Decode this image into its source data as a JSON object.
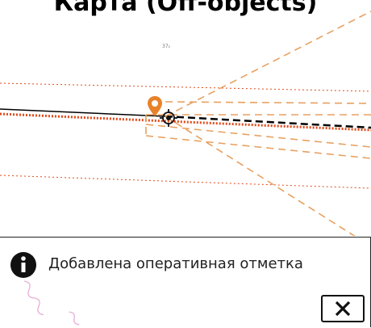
{
  "header": {
    "title": "Карта (Off-objects)"
  },
  "map": {
    "parcel_label": "37₂",
    "colors": {
      "boundary": "#e8a060",
      "red_line": "#e04a1a",
      "track": "#000000",
      "pin": "#e8822a"
    },
    "icons": [
      "location-pin-icon",
      "crosshair-icon"
    ]
  },
  "toast": {
    "message": "Добавлена оперативная отметка",
    "icons": [
      "info-icon",
      "close-icon"
    ]
  }
}
